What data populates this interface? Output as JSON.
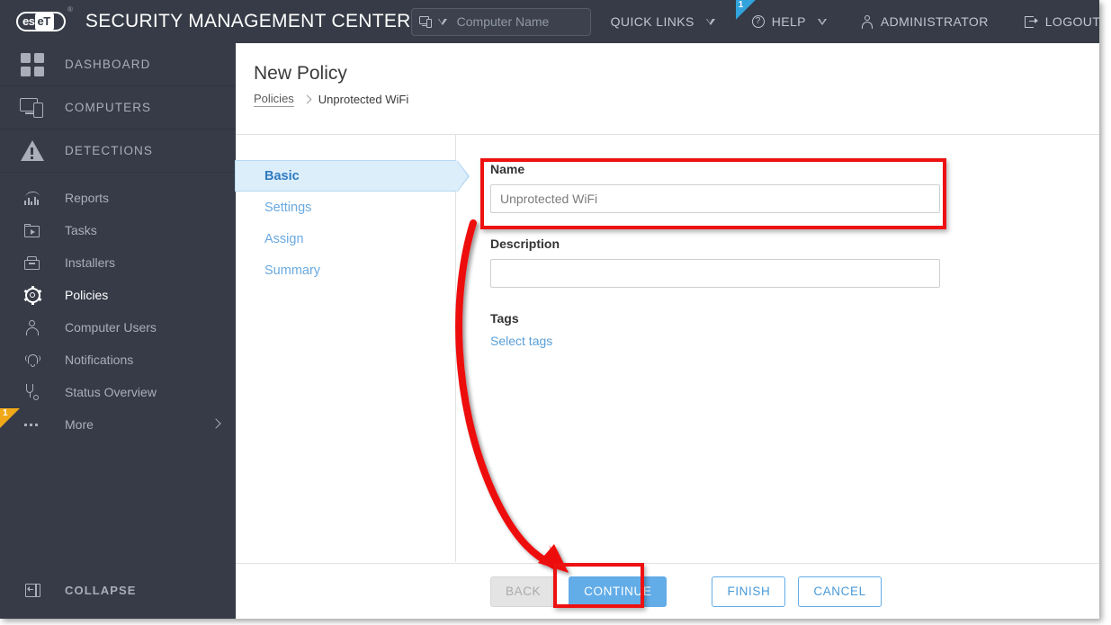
{
  "header": {
    "brand": {
      "logo_es": "es",
      "logo_et": "eT",
      "registered": "®",
      "title": "SECURITY MANAGEMENT CENTER"
    },
    "search": {
      "placeholder": "Computer Name",
      "value": "",
      "icon": "computer-device-icon",
      "caret": "chevron-down-icon"
    },
    "quick_links": {
      "label": "QUICK LINKS",
      "caret": "chevron-down-icon"
    },
    "help": {
      "label": "HELP",
      "icon": "question-circle-icon",
      "caret": "chevron-down-icon",
      "badge": "1"
    },
    "administrator": {
      "label": "ADMINISTRATOR",
      "icon": "person-icon"
    },
    "logout": {
      "label": "LOGOUT",
      "icon": "logout-icon"
    }
  },
  "sidebar": {
    "primary": [
      {
        "label": "DASHBOARD",
        "icon": "dashboard-grid-icon"
      },
      {
        "label": "COMPUTERS",
        "icon": "computer-device-icon"
      },
      {
        "label": "DETECTIONS",
        "icon": "warning-triangle-icon"
      }
    ],
    "secondary": [
      {
        "label": "Reports",
        "icon": "report-chart-icon",
        "active": false
      },
      {
        "label": "Tasks",
        "icon": "task-play-icon",
        "active": false
      },
      {
        "label": "Installers",
        "icon": "installer-box-icon",
        "active": false
      },
      {
        "label": "Policies",
        "icon": "gear-icon",
        "active": true
      },
      {
        "label": "Computer Users",
        "icon": "user-icon",
        "active": false
      },
      {
        "label": "Notifications",
        "icon": "bell-icon",
        "active": false
      },
      {
        "label": "Status Overview",
        "icon": "stethoscope-icon",
        "active": false
      },
      {
        "label": "More",
        "icon": "ellipsis-icon",
        "active": false,
        "badge": "1",
        "chevron": "chevron-right-icon"
      }
    ],
    "collapse": {
      "label": "COLLAPSE",
      "icon": "collapse-panel-icon"
    }
  },
  "page": {
    "title": "New Policy",
    "breadcrumb": {
      "parent": "Policies",
      "separator": "chevron-right-icon",
      "current": "Unprotected WiFi"
    }
  },
  "wizard": {
    "steps": [
      {
        "label": "Basic",
        "active": true
      },
      {
        "label": "Settings",
        "active": false
      },
      {
        "label": "Assign",
        "active": false
      },
      {
        "label": "Summary",
        "active": false
      }
    ],
    "form": {
      "name": {
        "label": "Name",
        "value": "Unprotected WiFi",
        "placeholder": ""
      },
      "description": {
        "label": "Description",
        "value": "",
        "placeholder": ""
      },
      "tags": {
        "label": "Tags",
        "link": "Select tags"
      }
    },
    "buttons": {
      "back": "BACK",
      "continue": "CONTINUE",
      "finish": "FINISH",
      "cancel": "CANCEL"
    }
  },
  "annotations": {
    "highlight_name_field": true,
    "highlight_continue_button": true,
    "arrow_from": "name-field",
    "arrow_to": "continue-button",
    "color": "#ee1111"
  },
  "colors": {
    "header_bg": "#363b47",
    "sidebar_bg": "#363b47",
    "accent_blue": "#62ace8",
    "step_active_bg": "#ddeefb",
    "badge_blue": "#32a3dd",
    "badge_amber": "#f0a818",
    "annotation_red": "#ee1111"
  }
}
